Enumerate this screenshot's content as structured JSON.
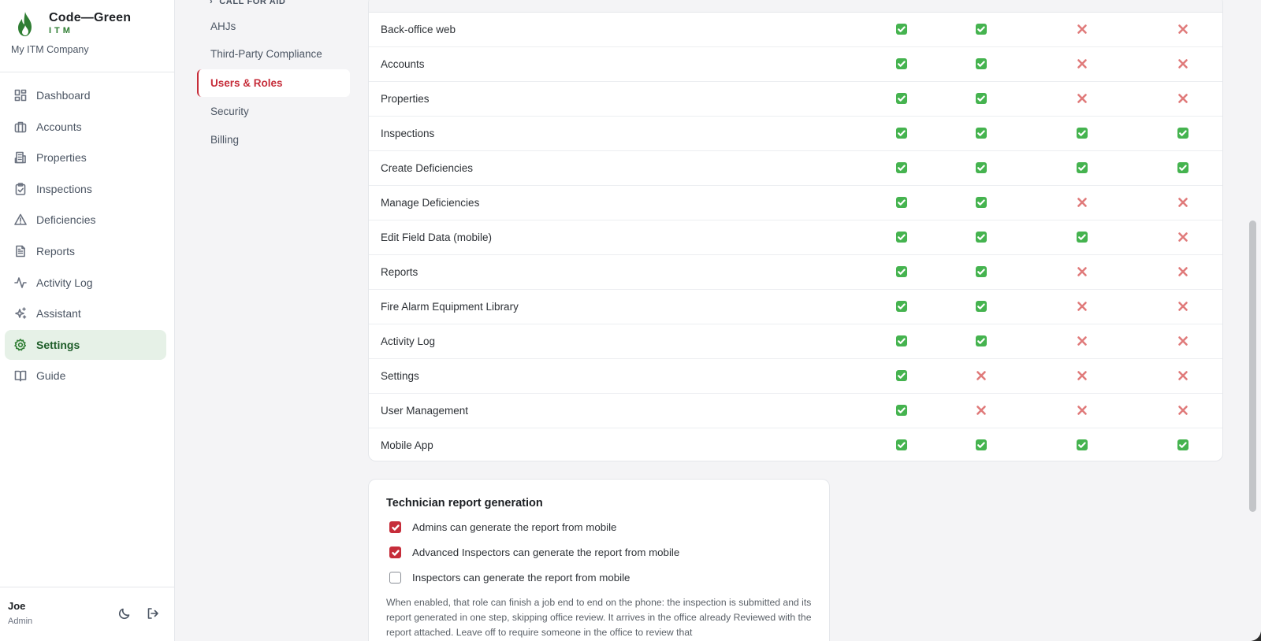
{
  "brand": {
    "name": "Code—Green",
    "sub": "ITM",
    "company": "My ITM Company"
  },
  "nav": [
    {
      "label": "Dashboard",
      "icon": "dashboard-icon"
    },
    {
      "label": "Accounts",
      "icon": "briefcase-icon"
    },
    {
      "label": "Properties",
      "icon": "building-icon"
    },
    {
      "label": "Inspections",
      "icon": "clipboard-check-icon"
    },
    {
      "label": "Deficiencies",
      "icon": "warning-triangle-icon"
    },
    {
      "label": "Reports",
      "icon": "document-icon"
    },
    {
      "label": "Activity Log",
      "icon": "activity-icon"
    },
    {
      "label": "Assistant",
      "icon": "sparkle-icon"
    },
    {
      "label": "Settings",
      "icon": "gear-icon",
      "active": true
    },
    {
      "label": "Guide",
      "icon": "book-icon"
    }
  ],
  "user": {
    "name": "Joe",
    "role": "Admin"
  },
  "settings_nav": {
    "section": "CALL FOR AID",
    "items": [
      "AHJs",
      "Third-Party Compliance",
      "Users & Roles",
      "Security",
      "Billing"
    ],
    "active": "Users & Roles"
  },
  "permissions": {
    "rows": [
      {
        "label": "Back-office web",
        "values": [
          true,
          true,
          false,
          false
        ]
      },
      {
        "label": "Accounts",
        "values": [
          true,
          true,
          false,
          false
        ]
      },
      {
        "label": "Properties",
        "values": [
          true,
          true,
          false,
          false
        ]
      },
      {
        "label": "Inspections",
        "values": [
          true,
          true,
          true,
          true
        ]
      },
      {
        "label": "Create Deficiencies",
        "values": [
          true,
          true,
          true,
          true
        ]
      },
      {
        "label": "Manage Deficiencies",
        "values": [
          true,
          true,
          false,
          false
        ]
      },
      {
        "label": "Edit Field Data (mobile)",
        "values": [
          true,
          true,
          true,
          false
        ]
      },
      {
        "label": "Reports",
        "values": [
          true,
          true,
          false,
          false
        ]
      },
      {
        "label": "Fire Alarm Equipment Library",
        "values": [
          true,
          true,
          false,
          false
        ]
      },
      {
        "label": "Activity Log",
        "values": [
          true,
          true,
          false,
          false
        ]
      },
      {
        "label": "Settings",
        "values": [
          true,
          false,
          false,
          false
        ]
      },
      {
        "label": "User Management",
        "values": [
          true,
          false,
          false,
          false
        ]
      },
      {
        "label": "Mobile App",
        "values": [
          true,
          true,
          true,
          true
        ]
      }
    ]
  },
  "technician": {
    "title": "Technician report generation",
    "options": [
      {
        "label": "Admins can generate the report from mobile",
        "checked": true
      },
      {
        "label": "Advanced Inspectors can generate the report from mobile",
        "checked": true
      },
      {
        "label": "Inspectors can generate the report from mobile",
        "checked": false
      }
    ],
    "note": "When enabled, that role can finish a job end to end on the phone: the inspection is submitted and its report generated in one step, skipping office review. It arrives in the office already Reviewed with the report attached. Leave off to require someone in the office to review that"
  },
  "colors": {
    "brand_green": "#2e7d32",
    "accent_red": "#c62d3a",
    "check_green": "#45b34f",
    "cross_red": "#e07a7a"
  }
}
